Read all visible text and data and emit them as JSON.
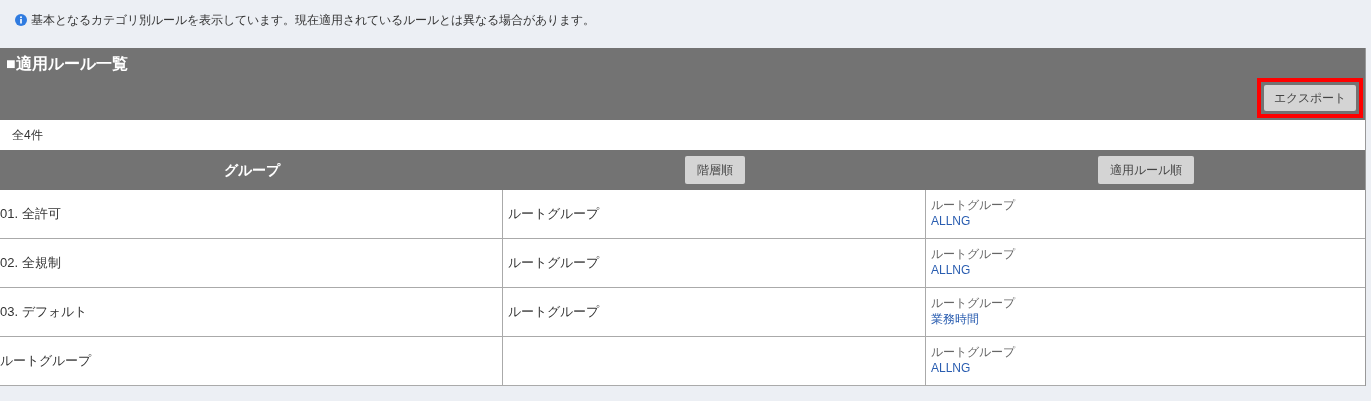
{
  "notice": "基本となるカテゴリ別ルールを表示しています。現在適用されているルールとは異なる場合があります。",
  "panel": {
    "title": "■適用ルール一覧",
    "export_button": {
      "label": "エクスポート",
      "highlighted": true
    },
    "count": "全4件"
  },
  "table": {
    "columns": [
      {
        "kind": "text",
        "label": "グループ"
      },
      {
        "kind": "button",
        "label": "階層順"
      },
      {
        "kind": "button",
        "label": "適用ルール順"
      }
    ],
    "rows": [
      {
        "group": "01. 全許可",
        "hierarchy": "ルートグループ",
        "rule_scope": "ルートグループ",
        "rule": "ALLNG"
      },
      {
        "group": "02. 全規制",
        "hierarchy": "ルートグループ",
        "rule_scope": "ルートグループ",
        "rule": "ALLNG"
      },
      {
        "group": "03. デフォルト",
        "hierarchy": "ルートグループ",
        "rule_scope": "ルートグループ",
        "rule": "業務時間"
      },
      {
        "group": "ルートグループ",
        "rule_scope": "ルートグループ",
        "rule": "ALLNG"
      }
    ]
  }
}
